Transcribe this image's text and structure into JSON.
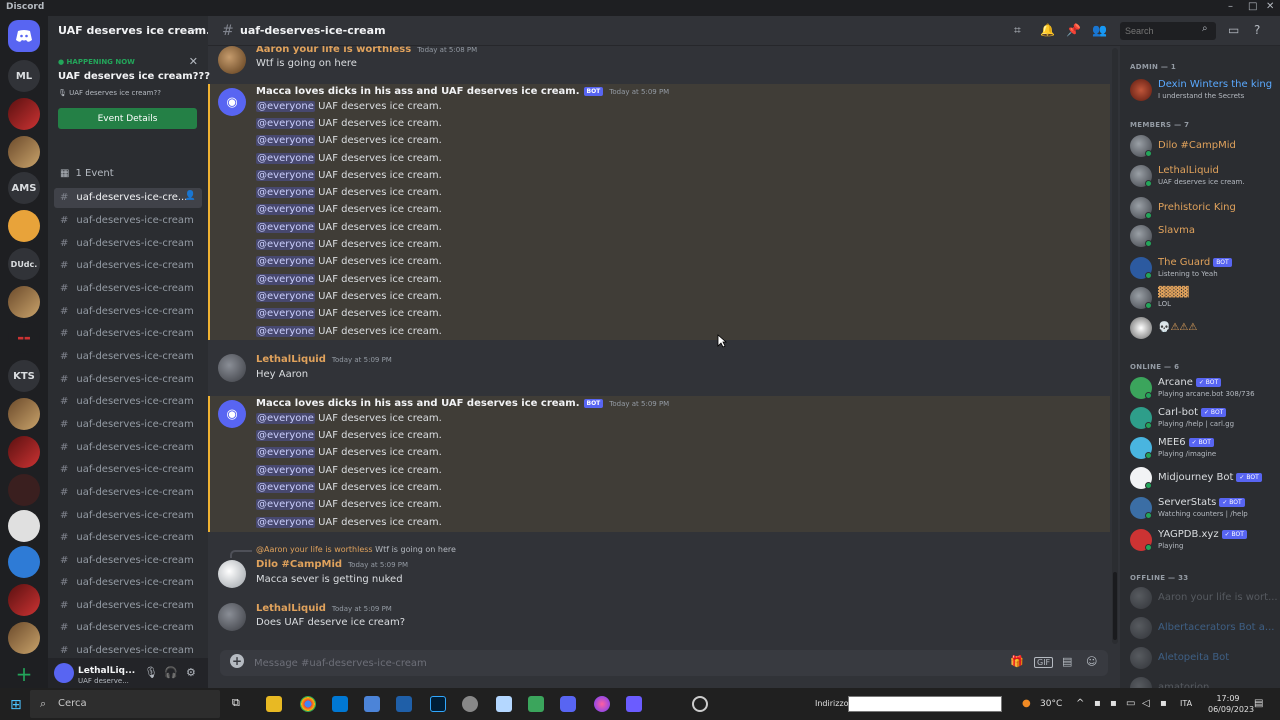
{
  "window": {
    "app_name": "Discord"
  },
  "rail": {
    "servers": [
      "ML",
      "AMS",
      "DUdc.",
      "KTS"
    ]
  },
  "server": {
    "name": "UAF deserves ice cream...",
    "event": {
      "status": "HAPPENING NOW",
      "title": "UAF deserves ice cream???",
      "subtitle": "UAF deserves ice cream??",
      "button": "Event Details"
    },
    "events_count": "1 Event"
  },
  "channels": [
    "uaf-deserves-ice-cre...",
    "uaf-deserves-ice-cream",
    "uaf-deserves-ice-cream",
    "uaf-deserves-ice-cream",
    "uaf-deserves-ice-cream",
    "uaf-deserves-ice-cream",
    "uaf-deserves-ice-cream",
    "uaf-deserves-ice-cream",
    "uaf-deserves-ice-cream",
    "uaf-deserves-ice-cream",
    "uaf-deserves-ice-cream",
    "uaf-deserves-ice-cream",
    "uaf-deserves-ice-cream",
    "uaf-deserves-ice-cream",
    "uaf-deserves-ice-cream",
    "uaf-deserves-ice-cream",
    "uaf-deserves-ice-cream",
    "uaf-deserves-ice-cream",
    "uaf-deserves-ice-cream",
    "uaf-deserves-ice-cream",
    "uaf-deserves-ice-cream"
  ],
  "user_panel": {
    "name": "LethalLiq...",
    "status": "UAF deserve..."
  },
  "header": {
    "channel": "uaf-deserves-ice-cream",
    "search_placeholder": "Search"
  },
  "messages": {
    "m1": {
      "author": "Aaron your life is worthless",
      "time": "Today at 5:08 PM",
      "text": "Wtf is going on here"
    },
    "m2": {
      "author": "Macca loves dicks in his ass and UAF deserves ice cream.",
      "bot": "BOT",
      "time": "Today at 5:09 PM"
    },
    "m3": {
      "author": "LethalLiquid",
      "time": "Today at 5:09 PM",
      "text": "Hey Aaron"
    },
    "m4": {
      "author": "Macca loves dicks in his ass and UAF deserves ice cream.",
      "bot": "BOT",
      "time": "Today at 5:09 PM"
    },
    "m5": {
      "reply_to": "@Aaron your life is worthless",
      "reply_text": "Wtf is going on here",
      "author": "Dilo #CampMid",
      "time": "Today at 5:09 PM",
      "text": "Macca sever is getting nuked"
    },
    "m6": {
      "author": "LethalLiquid",
      "time": "Today at 5:09 PM",
      "text": "Does UAF deserve ice cream?"
    },
    "mention": "@everyone",
    "spam_text": "UAF deserves ice cream."
  },
  "composer": {
    "placeholder": "Message #uaf-deserves-ice-cream"
  },
  "members": {
    "admin_header": "ADMIN — 1",
    "admin": [
      {
        "name": "Dexin Winters the king",
        "status": "I understand the Secrets"
      }
    ],
    "members_header": "MEMBERS — 7",
    "members": [
      {
        "name": "Dilo #CampMid",
        "status": ""
      },
      {
        "name": "LethalLiquid",
        "status": "UAF deserves ice cream."
      },
      {
        "name": "Prehistoric King",
        "status": ""
      },
      {
        "name": "Slavma",
        "status": ""
      },
      {
        "name": "The Guard",
        "bot": "BOT",
        "status": "Listening to Yeah"
      },
      {
        "name": "",
        "status": "LOL"
      },
      {
        "name": "",
        "status": ""
      }
    ],
    "online_header": "ONLINE — 6",
    "online": [
      {
        "name": "Arcane",
        "bot": "✓ BOT",
        "status": "Playing arcane.bot 308/736"
      },
      {
        "name": "Carl-bot",
        "bot": "✓ BOT",
        "status": "Playing /help | carl.gg"
      },
      {
        "name": "MEE6",
        "bot": "✓ BOT",
        "status": "Playing /imagine"
      },
      {
        "name": "Midjourney Bot",
        "bot": "✓ BOT",
        "status": ""
      },
      {
        "name": "ServerStats",
        "bot": "✓ BOT",
        "status": "Watching counters | /help"
      },
      {
        "name": "YAGPDB.xyz",
        "bot": "✓ BOT",
        "status": "Playing"
      }
    ],
    "offline_header": "OFFLINE — 33",
    "offline": [
      {
        "name": "Aaron your life is wort..."
      },
      {
        "name": "Albertacerators Bot a..."
      },
      {
        "name": "Aletopeita Bot"
      },
      {
        "name": "amatorion"
      }
    ]
  },
  "taskbar": {
    "search": "Cerca",
    "address_label": "Indirizzo",
    "temperature": "30°C",
    "lang": "ITA",
    "time": "17:09",
    "date": "06/09/2023"
  },
  "colors": {
    "accent": "#5865f2",
    "mention_highlight": "#f0b232",
    "online": "#23a55a",
    "event_button": "#248046",
    "author_orange": "#e0a25c"
  }
}
